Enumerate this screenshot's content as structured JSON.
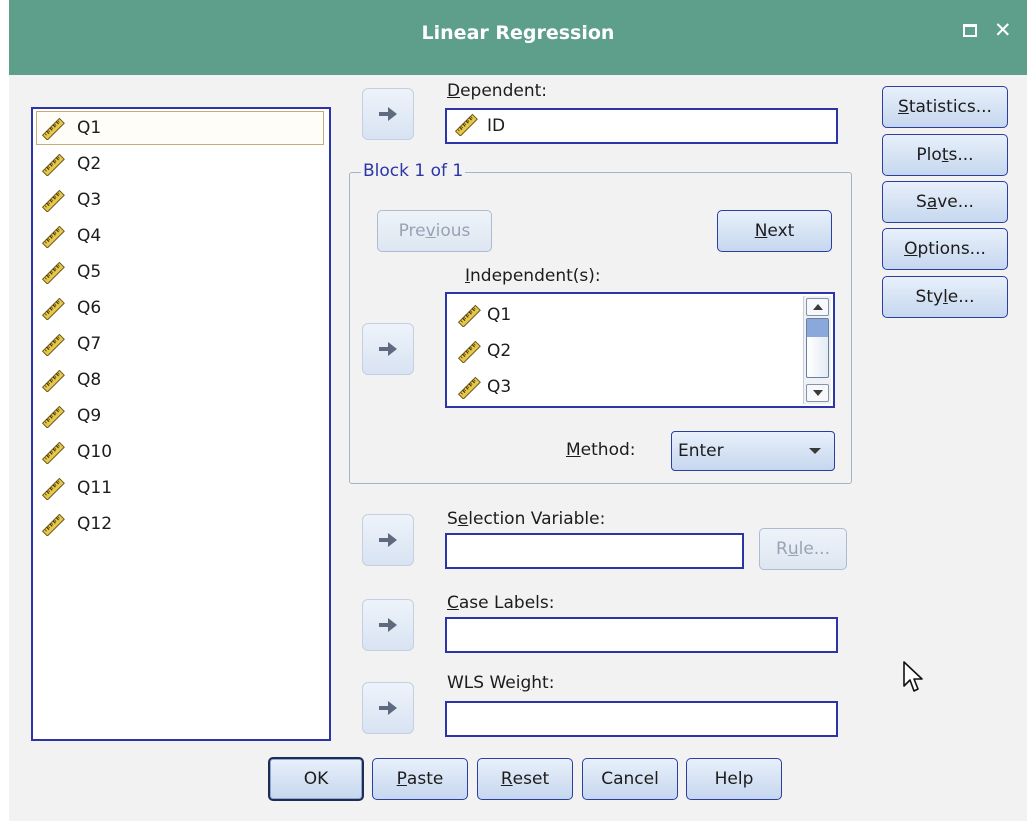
{
  "window": {
    "title": "Linear Regression",
    "maximize_icon": "maximize-icon",
    "close_icon": "close-icon",
    "close_glyph": "✕"
  },
  "source_variables": {
    "icon": "ruler-scale-icon",
    "items": [
      "Q1",
      "Q2",
      "Q3",
      "Q4",
      "Q5",
      "Q6",
      "Q7",
      "Q8",
      "Q9",
      "Q10",
      "Q11",
      "Q12"
    ]
  },
  "dependent": {
    "label_mnemonic": "D",
    "label_rest": "ependent:",
    "value": "ID"
  },
  "block": {
    "legend": "Block 1 of 1",
    "previous_pre": "Pre",
    "previous_mnemonic": "v",
    "previous_post": "ious",
    "next_mnemonic": "N",
    "next_rest": "ext"
  },
  "independents": {
    "label_mnemonic": "I",
    "label_rest": "ndependent(s):",
    "items": [
      "Q1",
      "Q2",
      "Q3"
    ]
  },
  "method": {
    "label_mnemonic": "M",
    "label_rest": "ethod:",
    "value": "Enter"
  },
  "selection": {
    "label_pre": "S",
    "label_mnemonic": "e",
    "label_post": "lection Variable:",
    "value": "",
    "rule_pre": "R",
    "rule_mnemonic": "u",
    "rule_post": "le..."
  },
  "case_labels": {
    "label_mnemonic": "C",
    "label_rest": "ase Labels:",
    "value": ""
  },
  "wls": {
    "label_pre": "WLS Wei",
    "label_mnemonic": "g",
    "label_post": "ht:",
    "value": ""
  },
  "side_buttons": {
    "statistics_mnemonic": "S",
    "statistics_rest": "tatistics...",
    "plots_pre": "Plo",
    "plots_mnemonic": "t",
    "plots_post": "s...",
    "save_pre": "S",
    "save_mnemonic": "a",
    "save_post": "ve...",
    "options_mnemonic": "O",
    "options_rest": "ptions...",
    "style_pre": "Sty",
    "style_mnemonic": "l",
    "style_post": "e..."
  },
  "bottom_buttons": {
    "ok": "OK",
    "paste_mnemonic": "P",
    "paste_rest": "aste",
    "reset_mnemonic": "R",
    "reset_rest": "eset",
    "cancel": "Cancel",
    "help": "Help"
  },
  "colors": {
    "titlebar": "#5e9f8c",
    "list_border": "#2b35a8",
    "button_border": "#2b3fa0"
  },
  "arrow_icon": "right-arrow-icon",
  "cursor_icon": "mouse-pointer-icon"
}
